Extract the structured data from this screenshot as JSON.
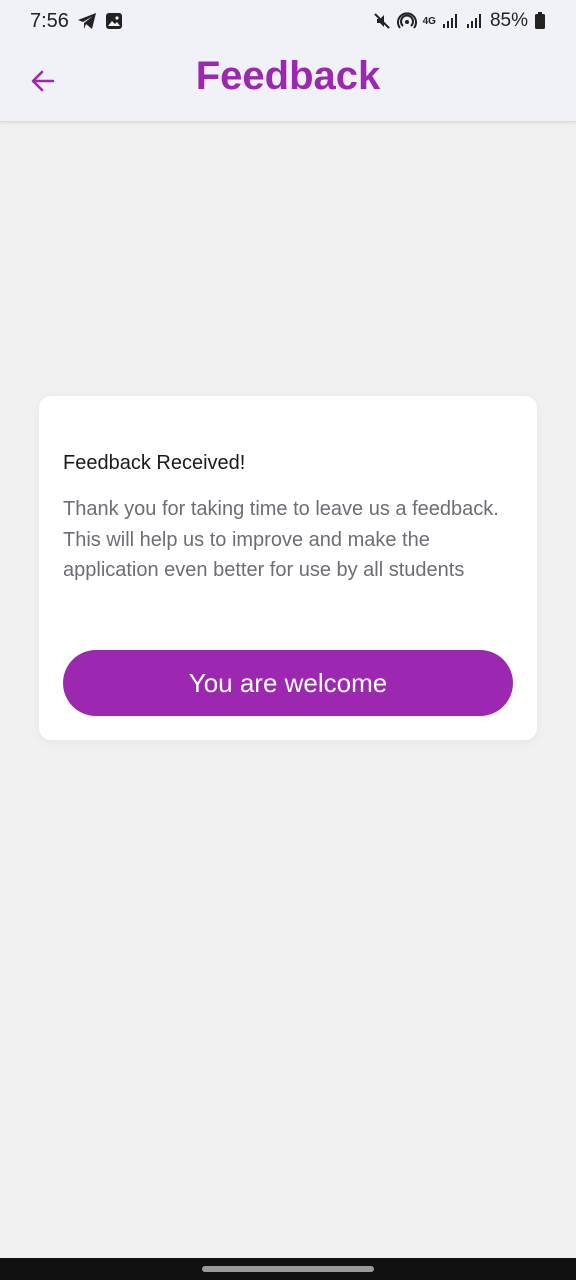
{
  "status_bar": {
    "time": "7:56",
    "battery": "85%",
    "network": "4G",
    "icons": [
      "telegram-icon",
      "image-icon",
      "mute-icon",
      "hotspot-icon",
      "signal-icon",
      "battery-icon"
    ]
  },
  "header": {
    "title": "Feedback",
    "back_icon": "arrow-left-icon"
  },
  "dialog": {
    "title": "Feedback Received!",
    "message": "Thank you for taking time to leave us a feedback. This will help us to improve and make the application even better for use by all students",
    "button_label": "You are welcome"
  },
  "colors": {
    "accent": "#9c27b0",
    "background": "#f1f1f2",
    "card": "#ffffff",
    "message_text": "#6b6e75"
  }
}
